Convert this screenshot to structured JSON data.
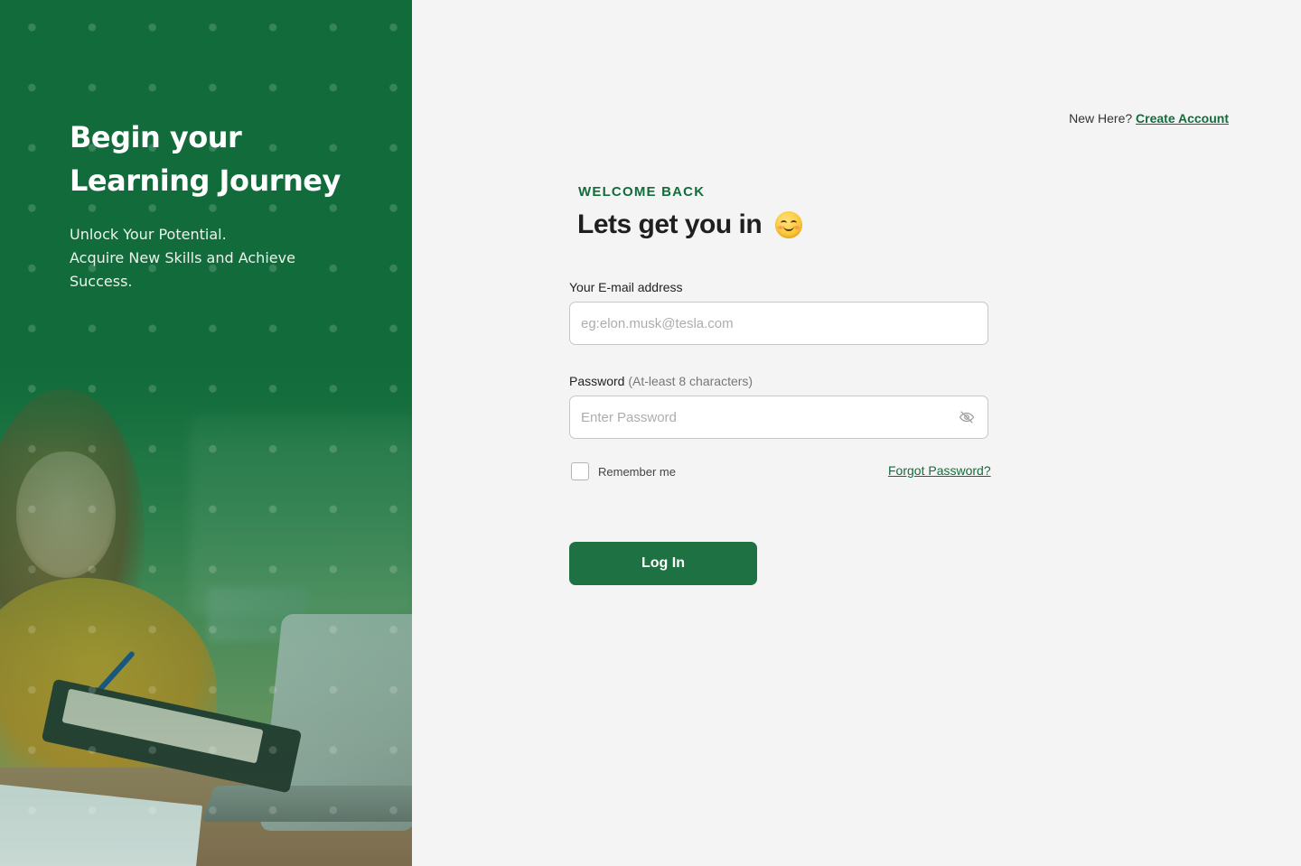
{
  "left_panel": {
    "title_line1": "Begin your",
    "title_line2": "Learning Journey",
    "subtitle_line1": "Unlock Your Potential.",
    "subtitle_line2": "Acquire New Skills and Achieve",
    "subtitle_line3": "Success."
  },
  "header": {
    "new_here": "New Here?",
    "create_account": "Create Account"
  },
  "form": {
    "eyebrow": "WELCOME BACK",
    "headline": "Lets get you in",
    "email_label": "Your E-mail address",
    "email_placeholder": "eg:elon.musk@tesla.com",
    "email_value": "",
    "password_label": "Password",
    "password_hint": "(At-least 8 characters)",
    "password_placeholder": "Enter Password",
    "password_value": "",
    "remember_label": "Remember me",
    "remember_checked": false,
    "forgot_label": "Forgot Password?",
    "login_label": "Log In"
  },
  "icons": {
    "headline_emoji": "smiling-face-emoji",
    "password_toggle": "eye-off-icon"
  },
  "colors": {
    "brand_green": "#126c3b",
    "button_green": "#1e7142",
    "background": "#f4f4f4"
  }
}
